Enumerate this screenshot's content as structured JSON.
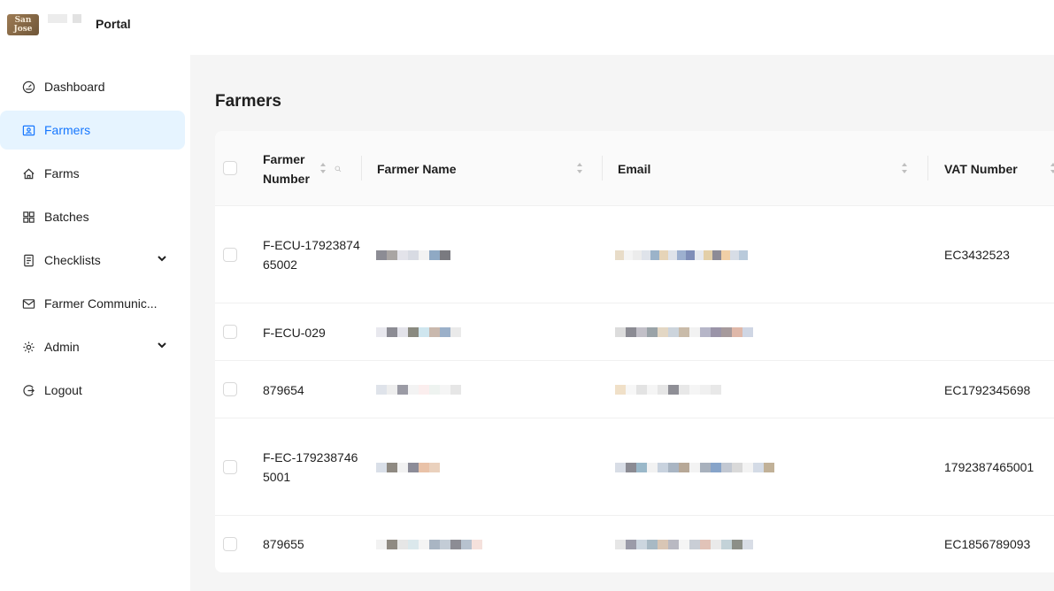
{
  "app": {
    "portal_title": "Portal",
    "logo_text": "San Jose"
  },
  "sidebar": {
    "items": [
      {
        "label": "Dashboard",
        "icon": "dashboard-icon",
        "active": false
      },
      {
        "label": "Farmers",
        "icon": "farmers-icon",
        "active": true
      },
      {
        "label": "Farms",
        "icon": "home-icon",
        "active": false
      },
      {
        "label": "Batches",
        "icon": "batches-icon",
        "active": false
      },
      {
        "label": "Checklists",
        "icon": "checklist-icon",
        "active": false,
        "expandable": true
      },
      {
        "label": "Farmer Communic...",
        "icon": "mail-icon",
        "active": false
      },
      {
        "label": "Admin",
        "icon": "settings-icon",
        "active": false,
        "expandable": true
      },
      {
        "label": "Logout",
        "icon": "logout-icon",
        "active": false
      }
    ]
  },
  "page": {
    "title": "Farmers"
  },
  "table": {
    "columns": {
      "farmer_number": "Farmer Number",
      "farmer_name": "Farmer Name",
      "email": "Email",
      "vat_number": "VAT Number"
    },
    "rows": [
      {
        "farmer_number": "F-ECU-1792387465002",
        "vat_number": "EC3432523"
      },
      {
        "farmer_number": "F-ECU-029",
        "vat_number": ""
      },
      {
        "farmer_number": "879654",
        "vat_number": "EC1792345698"
      },
      {
        "farmer_number": "F-EC-1792387465001",
        "vat_number": "1792387465001"
      },
      {
        "farmer_number": "879655",
        "vat_number": "EC1856789093"
      }
    ]
  },
  "colors": {
    "accent": "#1677ff",
    "active_bg": "#e6f4ff",
    "main_bg": "#f5f5f5"
  }
}
